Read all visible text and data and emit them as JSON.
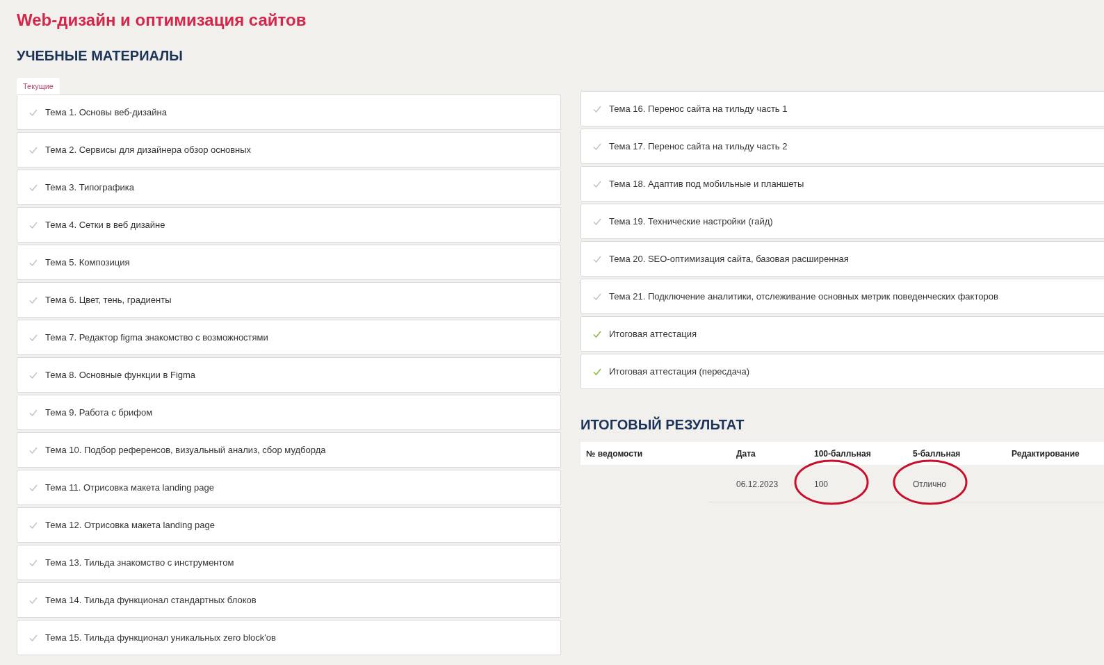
{
  "title": "Web-дизайн и оптимизация сайтов",
  "materials": {
    "heading": "УЧЕБНЫЕ МАТЕРИАЛЫ",
    "tabs": [
      {
        "label": "Текущие",
        "selected": true
      }
    ],
    "left": [
      {
        "label": "Тема 1. Основы веб-дизайна",
        "completed": false
      },
      {
        "label": "Тема 2. Сервисы для дизайнера обзор основных",
        "completed": false
      },
      {
        "label": "Тема 3. Типографика",
        "completed": false
      },
      {
        "label": "Тема 4. Сетки в веб дизайне",
        "completed": false
      },
      {
        "label": "Тема 5. Композиция",
        "completed": false
      },
      {
        "label": "Тема 6. Цвет, тень, градиенты",
        "completed": false
      },
      {
        "label": "Тема 7. Редактор figma знакомство с возможностями",
        "completed": false
      },
      {
        "label": "Тема 8. Основные функции в Figma",
        "completed": false
      },
      {
        "label": "Тема 9. Работа с брифом",
        "completed": false
      },
      {
        "label": "Тема 10. Подбор референсов, визуальный анализ, сбор мудборда",
        "completed": false
      },
      {
        "label": "Тема 11. Отрисовка макета landing page",
        "completed": false
      },
      {
        "label": "Тема 12. Отрисовка макета landing page",
        "completed": false
      },
      {
        "label": "Тема 13. Тильда знакомство с инструментом",
        "completed": false
      },
      {
        "label": "Тема 14. Тильда функционал стандартных блоков",
        "completed": false
      },
      {
        "label": "Тема 15. Тильда функционал уникальных zero block'ов",
        "completed": false
      }
    ],
    "right": [
      {
        "label": "Тема 16. Перенос сайта на тильду часть 1",
        "completed": false
      },
      {
        "label": "Тема 17. Перенос сайта на тильду часть 2",
        "completed": false
      },
      {
        "label": "Тема 18. Адаптив под мобильные и планшеты",
        "completed": false
      },
      {
        "label": "Тема 19. Технические настройки (гайд)",
        "completed": false
      },
      {
        "label": "Тема 20. SEO-оптимизация сайта, базовая расширенная",
        "completed": false
      },
      {
        "label": "Тема 21. Подключение аналитики, отслеживание основных метрик поведенческих факторов",
        "completed": false
      },
      {
        "label": "Итоговая аттестация",
        "completed": true
      },
      {
        "label": "Итоговая аттестация (пересдача)",
        "completed": true
      }
    ]
  },
  "result": {
    "heading": "ИТОГОВЫЙ РЕЗУЛЬТАТ",
    "columns": [
      "№ ведомости",
      "Дата",
      "100-балльная",
      "5-балльная",
      "Редактирование"
    ],
    "rows": [
      {
        "date": {
          "text": "06.12.2023",
          "circled": false
        },
        "score_100": {
          "text": "100",
          "circled": true
        },
        "score_5": {
          "text": "Отлично",
          "circled": true
        }
      }
    ]
  }
}
